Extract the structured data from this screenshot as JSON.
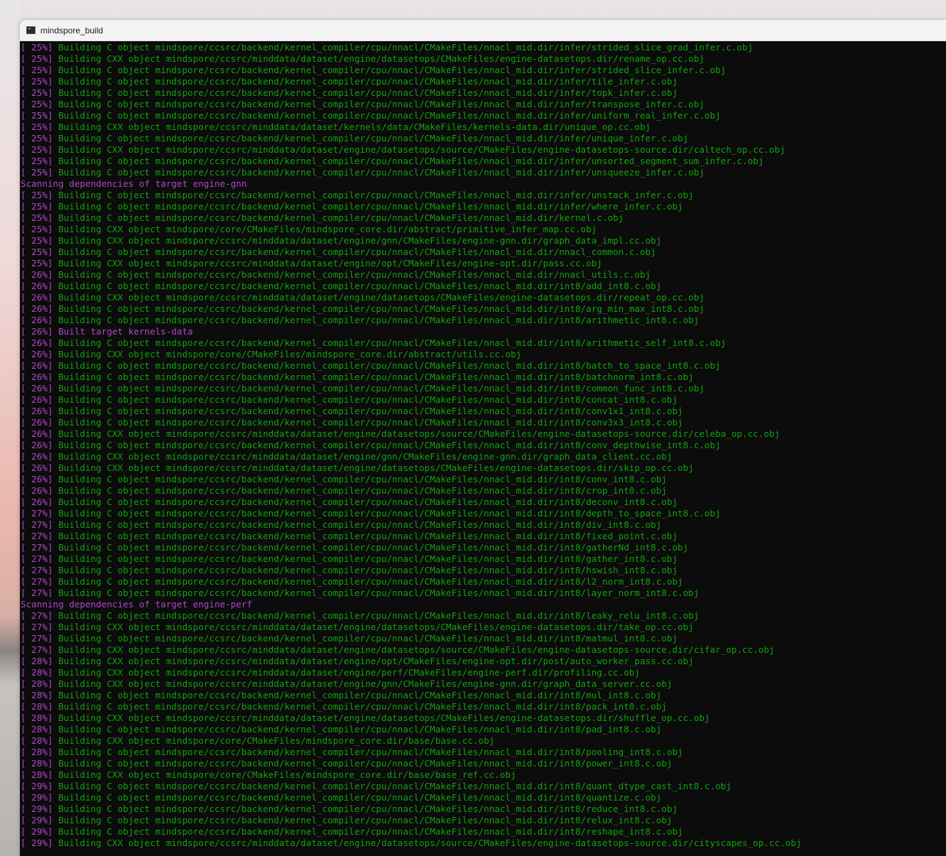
{
  "window": {
    "title": "mindspore_build",
    "icon": "terminal-icon"
  },
  "colors": {
    "background": "#0c0c0c",
    "green": "#13a10e",
    "magenta": "#b148c6"
  },
  "lines": [
    {
      "pct": "[ 25%]",
      "text": " Building C object mindspore/ccsrc/backend/kernel_compiler/cpu/nnacl/CMakeFiles/nnacl_mid.dir/infer/strided_slice_grad_infer.c.obj"
    },
    {
      "pct": "[ 25%]",
      "text": " Building CXX object mindspore/ccsrc/minddata/dataset/engine/datasetops/CMakeFiles/engine-datasetops.dir/rename_op.cc.obj"
    },
    {
      "pct": "[ 25%]",
      "text": " Building C object mindspore/ccsrc/backend/kernel_compiler/cpu/nnacl/CMakeFiles/nnacl_mid.dir/infer/strided_slice_infer.c.obj"
    },
    {
      "pct": "[ 25%]",
      "text": " Building C object mindspore/ccsrc/backend/kernel_compiler/cpu/nnacl/CMakeFiles/nnacl_mid.dir/infer/tile_infer.c.obj"
    },
    {
      "pct": "[ 25%]",
      "text": " Building C object mindspore/ccsrc/backend/kernel_compiler/cpu/nnacl/CMakeFiles/nnacl_mid.dir/infer/topk_infer.c.obj"
    },
    {
      "pct": "[ 25%]",
      "text": " Building C object mindspore/ccsrc/backend/kernel_compiler/cpu/nnacl/CMakeFiles/nnacl_mid.dir/infer/transpose_infer.c.obj"
    },
    {
      "pct": "[ 25%]",
      "text": " Building C object mindspore/ccsrc/backend/kernel_compiler/cpu/nnacl/CMakeFiles/nnacl_mid.dir/infer/uniform_real_infer.c.obj"
    },
    {
      "pct": "[ 25%]",
      "text": " Building CXX object mindspore/ccsrc/minddata/dataset/kernels/data/CMakeFiles/kernels-data.dir/unique_op.cc.obj"
    },
    {
      "pct": "[ 25%]",
      "text": " Building C object mindspore/ccsrc/backend/kernel_compiler/cpu/nnacl/CMakeFiles/nnacl_mid.dir/infer/unique_infer.c.obj"
    },
    {
      "pct": "[ 25%]",
      "text": " Building CXX object mindspore/ccsrc/minddata/dataset/engine/datasetops/source/CMakeFiles/engine-datasetops-source.dir/caltech_op.cc.obj"
    },
    {
      "pct": "[ 25%]",
      "text": " Building C object mindspore/ccsrc/backend/kernel_compiler/cpu/nnacl/CMakeFiles/nnacl_mid.dir/infer/unsorted_segment_sum_infer.c.obj"
    },
    {
      "pct": "[ 25%]",
      "text": " Building C object mindspore/ccsrc/backend/kernel_compiler/cpu/nnacl/CMakeFiles/nnacl_mid.dir/infer/unsqueeze_infer.c.obj"
    },
    {
      "pct": "",
      "text": "Scanning dependencies of target engine-gnn",
      "scan": true
    },
    {
      "pct": "[ 25%]",
      "text": " Building C object mindspore/ccsrc/backend/kernel_compiler/cpu/nnacl/CMakeFiles/nnacl_mid.dir/infer/unstack_infer.c.obj"
    },
    {
      "pct": "[ 25%]",
      "text": " Building C object mindspore/ccsrc/backend/kernel_compiler/cpu/nnacl/CMakeFiles/nnacl_mid.dir/infer/where_infer.c.obj"
    },
    {
      "pct": "[ 25%]",
      "text": " Building C object mindspore/ccsrc/backend/kernel_compiler/cpu/nnacl/CMakeFiles/nnacl_mid.dir/kernel.c.obj"
    },
    {
      "pct": "[ 25%]",
      "text": " Building CXX object mindspore/core/CMakeFiles/mindspore_core.dir/abstract/primitive_infer_map.cc.obj"
    },
    {
      "pct": "[ 25%]",
      "text": " Building CXX object mindspore/ccsrc/minddata/dataset/engine/gnn/CMakeFiles/engine-gnn.dir/graph_data_impl.cc.obj"
    },
    {
      "pct": "[ 25%]",
      "text": " Building C object mindspore/ccsrc/backend/kernel_compiler/cpu/nnacl/CMakeFiles/nnacl_mid.dir/nnacl_common.c.obj"
    },
    {
      "pct": "[ 25%]",
      "text": " Building CXX object mindspore/ccsrc/minddata/dataset/engine/opt/CMakeFiles/engine-opt.dir/pass.cc.obj"
    },
    {
      "pct": "[ 26%]",
      "text": " Building C object mindspore/ccsrc/backend/kernel_compiler/cpu/nnacl/CMakeFiles/nnacl_mid.dir/nnacl_utils.c.obj"
    },
    {
      "pct": "[ 26%]",
      "text": " Building C object mindspore/ccsrc/backend/kernel_compiler/cpu/nnacl/CMakeFiles/nnacl_mid.dir/int8/add_int8.c.obj"
    },
    {
      "pct": "[ 26%]",
      "text": " Building CXX object mindspore/ccsrc/minddata/dataset/engine/datasetops/CMakeFiles/engine-datasetops.dir/repeat_op.cc.obj"
    },
    {
      "pct": "[ 26%]",
      "text": " Building C object mindspore/ccsrc/backend/kernel_compiler/cpu/nnacl/CMakeFiles/nnacl_mid.dir/int8/arg_min_max_int8.c.obj"
    },
    {
      "pct": "[ 26%]",
      "text": " Building C object mindspore/ccsrc/backend/kernel_compiler/cpu/nnacl/CMakeFiles/nnacl_mid.dir/int8/arithmetic_int8.c.obj"
    },
    {
      "pct": "[ 26%]",
      "text": " Built target kernels-data",
      "built": true
    },
    {
      "pct": "[ 26%]",
      "text": " Building C object mindspore/ccsrc/backend/kernel_compiler/cpu/nnacl/CMakeFiles/nnacl_mid.dir/int8/arithmetic_self_int8.c.obj"
    },
    {
      "pct": "[ 26%]",
      "text": " Building CXX object mindspore/core/CMakeFiles/mindspore_core.dir/abstract/utils.cc.obj"
    },
    {
      "pct": "[ 26%]",
      "text": " Building C object mindspore/ccsrc/backend/kernel_compiler/cpu/nnacl/CMakeFiles/nnacl_mid.dir/int8/batch_to_space_int8.c.obj"
    },
    {
      "pct": "[ 26%]",
      "text": " Building C object mindspore/ccsrc/backend/kernel_compiler/cpu/nnacl/CMakeFiles/nnacl_mid.dir/int8/batchnorm_int8.c.obj"
    },
    {
      "pct": "[ 26%]",
      "text": " Building C object mindspore/ccsrc/backend/kernel_compiler/cpu/nnacl/CMakeFiles/nnacl_mid.dir/int8/common_func_int8.c.obj"
    },
    {
      "pct": "[ 26%]",
      "text": " Building C object mindspore/ccsrc/backend/kernel_compiler/cpu/nnacl/CMakeFiles/nnacl_mid.dir/int8/concat_int8.c.obj"
    },
    {
      "pct": "[ 26%]",
      "text": " Building C object mindspore/ccsrc/backend/kernel_compiler/cpu/nnacl/CMakeFiles/nnacl_mid.dir/int8/conv1x1_int8.c.obj"
    },
    {
      "pct": "[ 26%]",
      "text": " Building C object mindspore/ccsrc/backend/kernel_compiler/cpu/nnacl/CMakeFiles/nnacl_mid.dir/int8/conv3x3_int8.c.obj"
    },
    {
      "pct": "[ 26%]",
      "text": " Building CXX object mindspore/ccsrc/minddata/dataset/engine/datasetops/source/CMakeFiles/engine-datasetops-source.dir/celeba_op.cc.obj"
    },
    {
      "pct": "[ 26%]",
      "text": " Building C object mindspore/ccsrc/backend/kernel_compiler/cpu/nnacl/CMakeFiles/nnacl_mid.dir/int8/conv_depthwise_int8.c.obj"
    },
    {
      "pct": "[ 26%]",
      "text": " Building CXX object mindspore/ccsrc/minddata/dataset/engine/gnn/CMakeFiles/engine-gnn.dir/graph_data_client.cc.obj"
    },
    {
      "pct": "[ 26%]",
      "text": " Building CXX object mindspore/ccsrc/minddata/dataset/engine/datasetops/CMakeFiles/engine-datasetops.dir/skip_op.cc.obj"
    },
    {
      "pct": "[ 26%]",
      "text": " Building C object mindspore/ccsrc/backend/kernel_compiler/cpu/nnacl/CMakeFiles/nnacl_mid.dir/int8/conv_int8.c.obj"
    },
    {
      "pct": "[ 26%]",
      "text": " Building C object mindspore/ccsrc/backend/kernel_compiler/cpu/nnacl/CMakeFiles/nnacl_mid.dir/int8/crop_int8.c.obj"
    },
    {
      "pct": "[ 26%]",
      "text": " Building C object mindspore/ccsrc/backend/kernel_compiler/cpu/nnacl/CMakeFiles/nnacl_mid.dir/int8/deconv_int8.c.obj"
    },
    {
      "pct": "[ 27%]",
      "text": " Building C object mindspore/ccsrc/backend/kernel_compiler/cpu/nnacl/CMakeFiles/nnacl_mid.dir/int8/depth_to_space_int8.c.obj"
    },
    {
      "pct": "[ 27%]",
      "text": " Building C object mindspore/ccsrc/backend/kernel_compiler/cpu/nnacl/CMakeFiles/nnacl_mid.dir/int8/div_int8.c.obj"
    },
    {
      "pct": "[ 27%]",
      "text": " Building C object mindspore/ccsrc/backend/kernel_compiler/cpu/nnacl/CMakeFiles/nnacl_mid.dir/int8/fixed_point.c.obj"
    },
    {
      "pct": "[ 27%]",
      "text": " Building C object mindspore/ccsrc/backend/kernel_compiler/cpu/nnacl/CMakeFiles/nnacl_mid.dir/int8/gatherNd_int8.c.obj"
    },
    {
      "pct": "[ 27%]",
      "text": " Building C object mindspore/ccsrc/backend/kernel_compiler/cpu/nnacl/CMakeFiles/nnacl_mid.dir/int8/gather_int8.c.obj"
    },
    {
      "pct": "[ 27%]",
      "text": " Building C object mindspore/ccsrc/backend/kernel_compiler/cpu/nnacl/CMakeFiles/nnacl_mid.dir/int8/hswish_int8.c.obj"
    },
    {
      "pct": "[ 27%]",
      "text": " Building C object mindspore/ccsrc/backend/kernel_compiler/cpu/nnacl/CMakeFiles/nnacl_mid.dir/int8/l2_norm_int8.c.obj"
    },
    {
      "pct": "[ 27%]",
      "text": " Building C object mindspore/ccsrc/backend/kernel_compiler/cpu/nnacl/CMakeFiles/nnacl_mid.dir/int8/layer_norm_int8.c.obj"
    },
    {
      "pct": "",
      "text": "Scanning dependencies of target engine-perf",
      "scan": true
    },
    {
      "pct": "[ 27%]",
      "text": " Building C object mindspore/ccsrc/backend/kernel_compiler/cpu/nnacl/CMakeFiles/nnacl_mid.dir/int8/leaky_relu_int8.c.obj"
    },
    {
      "pct": "[ 27%]",
      "text": " Building CXX object mindspore/ccsrc/minddata/dataset/engine/datasetops/CMakeFiles/engine-datasetops.dir/take_op.cc.obj"
    },
    {
      "pct": "[ 27%]",
      "text": " Building C object mindspore/ccsrc/backend/kernel_compiler/cpu/nnacl/CMakeFiles/nnacl_mid.dir/int8/matmul_int8.c.obj"
    },
    {
      "pct": "[ 27%]",
      "text": " Building CXX object mindspore/ccsrc/minddata/dataset/engine/datasetops/source/CMakeFiles/engine-datasetops-source.dir/cifar_op.cc.obj"
    },
    {
      "pct": "[ 28%]",
      "text": " Building CXX object mindspore/ccsrc/minddata/dataset/engine/opt/CMakeFiles/engine-opt.dir/post/auto_worker_pass.cc.obj"
    },
    {
      "pct": "[ 28%]",
      "text": " Building CXX object mindspore/ccsrc/minddata/dataset/engine/perf/CMakeFiles/engine-perf.dir/profiling.cc.obj"
    },
    {
      "pct": "[ 28%]",
      "text": " Building CXX object mindspore/ccsrc/minddata/dataset/engine/gnn/CMakeFiles/engine-gnn.dir/graph_data_server.cc.obj"
    },
    {
      "pct": "[ 28%]",
      "text": " Building C object mindspore/ccsrc/backend/kernel_compiler/cpu/nnacl/CMakeFiles/nnacl_mid.dir/int8/mul_int8.c.obj"
    },
    {
      "pct": "[ 28%]",
      "text": " Building C object mindspore/ccsrc/backend/kernel_compiler/cpu/nnacl/CMakeFiles/nnacl_mid.dir/int8/pack_int8.c.obj"
    },
    {
      "pct": "[ 28%]",
      "text": " Building CXX object mindspore/ccsrc/minddata/dataset/engine/datasetops/CMakeFiles/engine-datasetops.dir/shuffle_op.cc.obj"
    },
    {
      "pct": "[ 28%]",
      "text": " Building C object mindspore/ccsrc/backend/kernel_compiler/cpu/nnacl/CMakeFiles/nnacl_mid.dir/int8/pad_int8.c.obj"
    },
    {
      "pct": "[ 28%]",
      "text": " Building CXX object mindspore/core/CMakeFiles/mindspore_core.dir/base/base.cc.obj"
    },
    {
      "pct": "[ 28%]",
      "text": " Building C object mindspore/ccsrc/backend/kernel_compiler/cpu/nnacl/CMakeFiles/nnacl_mid.dir/int8/pooling_int8.c.obj"
    },
    {
      "pct": "[ 28%]",
      "text": " Building C object mindspore/ccsrc/backend/kernel_compiler/cpu/nnacl/CMakeFiles/nnacl_mid.dir/int8/power_int8.c.obj"
    },
    {
      "pct": "[ 28%]",
      "text": " Building CXX object mindspore/core/CMakeFiles/mindspore_core.dir/base/base_ref.cc.obj"
    },
    {
      "pct": "[ 29%]",
      "text": " Building C object mindspore/ccsrc/backend/kernel_compiler/cpu/nnacl/CMakeFiles/nnacl_mid.dir/int8/quant_dtype_cast_int8.c.obj"
    },
    {
      "pct": "[ 29%]",
      "text": " Building C object mindspore/ccsrc/backend/kernel_compiler/cpu/nnacl/CMakeFiles/nnacl_mid.dir/int8/quantize.c.obj"
    },
    {
      "pct": "[ 29%]",
      "text": " Building C object mindspore/ccsrc/backend/kernel_compiler/cpu/nnacl/CMakeFiles/nnacl_mid.dir/int8/reduce_int8.c.obj"
    },
    {
      "pct": "[ 29%]",
      "text": " Building C object mindspore/ccsrc/backend/kernel_compiler/cpu/nnacl/CMakeFiles/nnacl_mid.dir/int8/relux_int8.c.obj"
    },
    {
      "pct": "[ 29%]",
      "text": " Building C object mindspore/ccsrc/backend/kernel_compiler/cpu/nnacl/CMakeFiles/nnacl_mid.dir/int8/reshape_int8.c.obj"
    },
    {
      "pct": "[ 29%]",
      "text": " Building CXX object mindspore/ccsrc/minddata/dataset/engine/datasetops/source/CMakeFiles/engine-datasetops-source.dir/cityscapes_op.cc.obj"
    }
  ]
}
